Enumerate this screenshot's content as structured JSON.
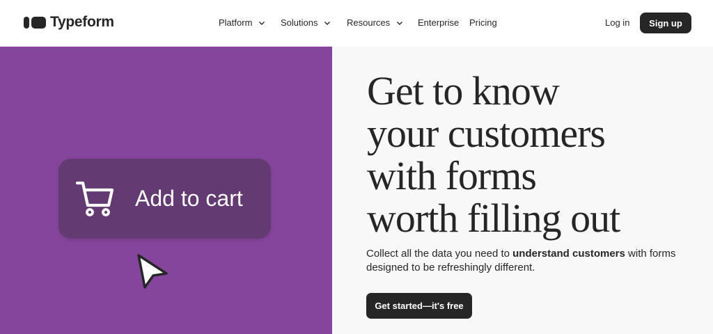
{
  "header": {
    "logo_text": "Typeform",
    "nav": [
      {
        "label": "Platform",
        "has_dropdown": true
      },
      {
        "label": "Solutions",
        "has_dropdown": true
      },
      {
        "label": "Resources",
        "has_dropdown": true
      },
      {
        "label": "Enterprise",
        "has_dropdown": false
      },
      {
        "label": "Pricing",
        "has_dropdown": false
      }
    ],
    "login_label": "Log in",
    "signup_label": "Sign up"
  },
  "hero_visual": {
    "button_label": "Add to cart",
    "icons": [
      "cart-icon",
      "cursor-arrow-icon"
    ]
  },
  "hero": {
    "headline_lines": [
      "Get to know",
      "your customers",
      "with forms",
      "worth filling out"
    ],
    "subtext_before": "Collect all the data you need to ",
    "subtext_bold": "understand customers",
    "subtext_after": " with forms designed to be refreshingly different.",
    "cta_label": "Get started—it's free"
  },
  "colors": {
    "brand_dark": "#262627",
    "hero_purple": "#86459c",
    "button_purple": "#633a71",
    "hero_right_bg": "#f8f8f9"
  }
}
